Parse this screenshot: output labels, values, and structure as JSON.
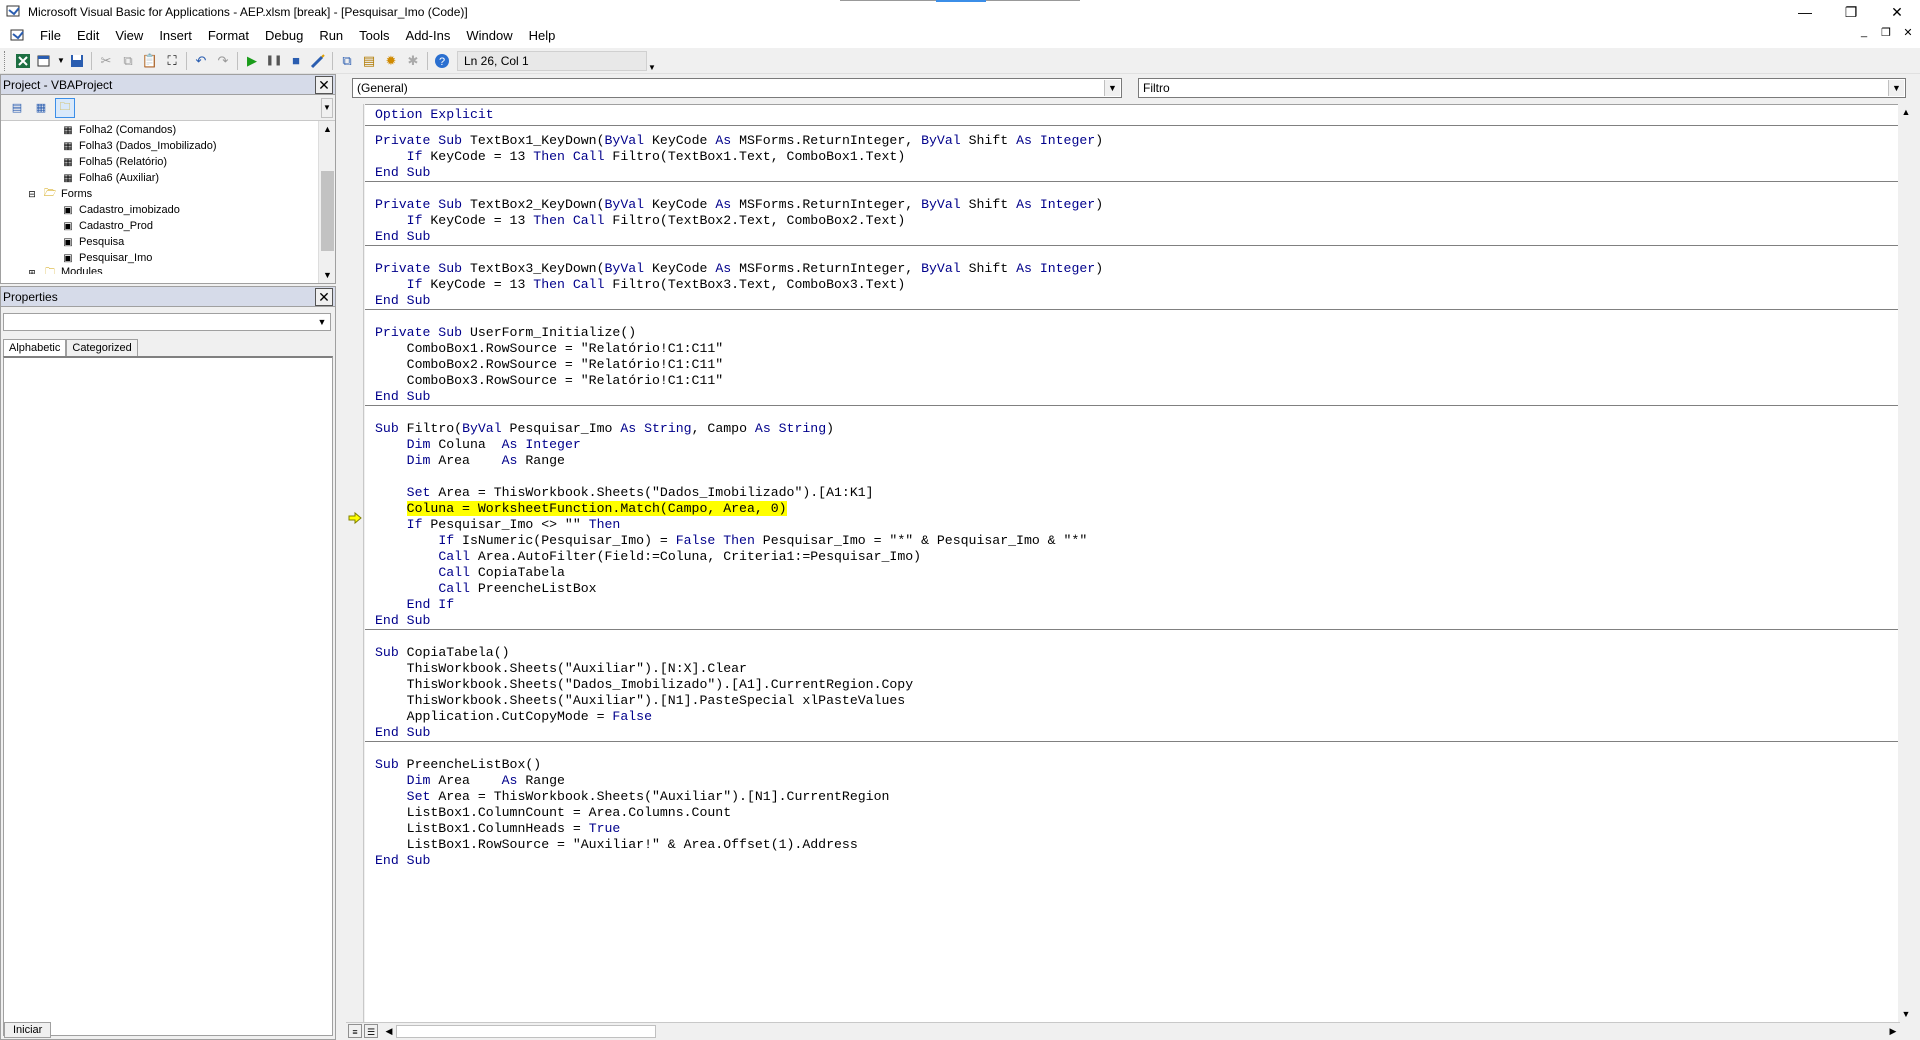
{
  "window": {
    "title": "Microsoft Visual Basic for Applications - AEP.xlsm [break] - [Pesquisar_Imo (Code)]"
  },
  "menubar": {
    "items": [
      "File",
      "Edit",
      "View",
      "Insert",
      "Format",
      "Debug",
      "Run",
      "Tools",
      "Add-Ins",
      "Window",
      "Help"
    ]
  },
  "toolbar": {
    "cursor_position": "Ln 26, Col 1"
  },
  "project_pane": {
    "title": "Project - VBAProject",
    "tree": [
      {
        "label": "Folha2 (Comandos)",
        "type": "sheet"
      },
      {
        "label": "Folha3 (Dados_Imobilizado)",
        "type": "sheet"
      },
      {
        "label": "Folha5 (Relatório)",
        "type": "sheet"
      },
      {
        "label": "Folha6 (Auxiliar)",
        "type": "sheet"
      },
      {
        "label": "Forms",
        "type": "folder"
      },
      {
        "label": "Cadastro_imobizado",
        "type": "form"
      },
      {
        "label": "Cadastro_Prod",
        "type": "form"
      },
      {
        "label": "Pesquisa",
        "type": "form"
      },
      {
        "label": "Pesquisar_Imo",
        "type": "form"
      },
      {
        "label": "Modules",
        "type": "folder"
      }
    ]
  },
  "properties_pane": {
    "title": "Properties",
    "tabs": [
      "Alphabetic",
      "Categorized"
    ]
  },
  "code_window": {
    "object_combo": "(General)",
    "procedure_combo": "Filtro"
  },
  "taskbar": {
    "start_label": "Iniciar"
  },
  "colors": {
    "keyword": "#00008b",
    "highlight": "#ffff00"
  }
}
